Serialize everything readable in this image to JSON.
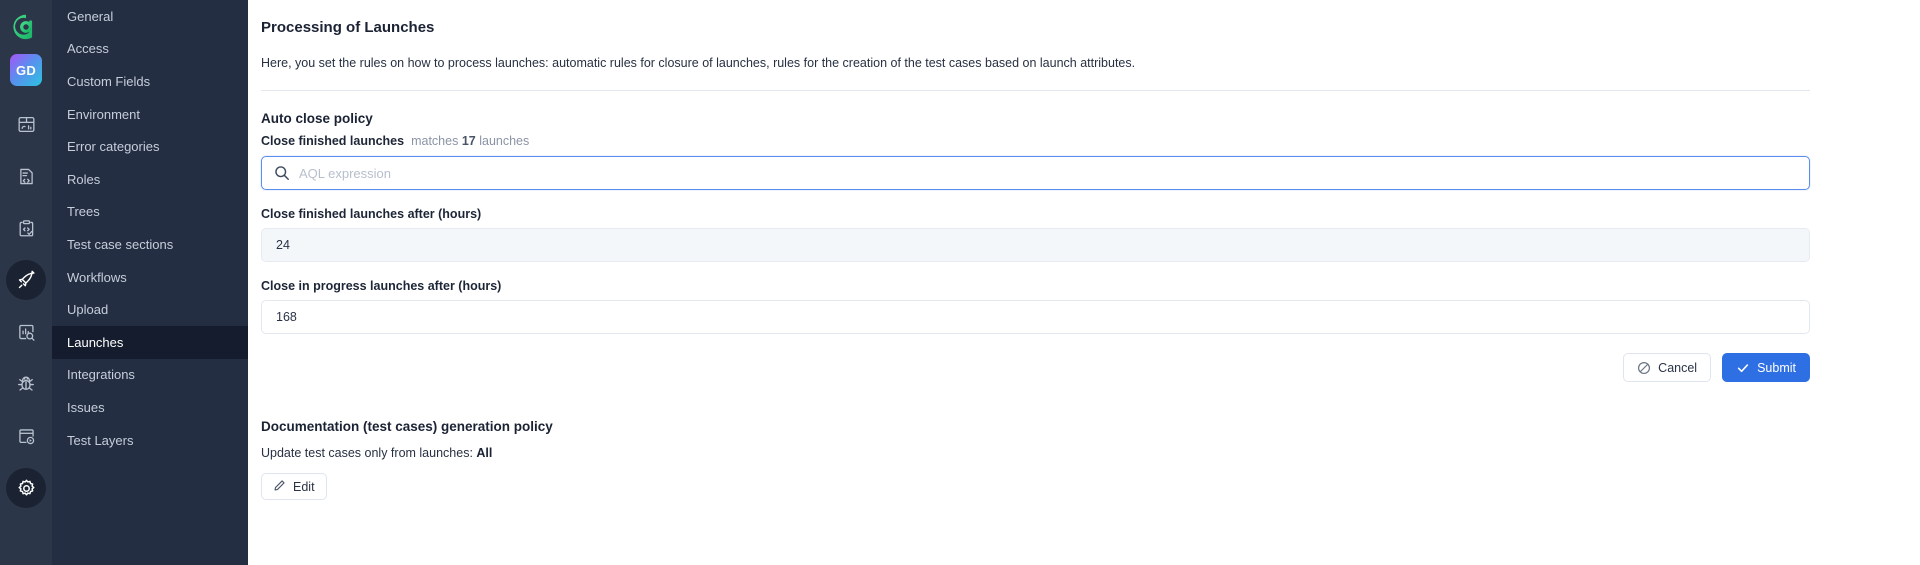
{
  "rail": {
    "avatar_initials": "GD",
    "items": [
      {
        "name": "logo-icon",
        "label": "Allure logo"
      },
      {
        "name": "avatar",
        "label": "GD"
      },
      {
        "name": "dashboards-icon",
        "label": "Dashboards"
      },
      {
        "name": "test-cases-code-icon",
        "label": "Test cases"
      },
      {
        "name": "clipboard-code-icon",
        "label": "Test plans"
      },
      {
        "name": "launches-rocket-icon",
        "label": "Launches"
      },
      {
        "name": "analytics-search-icon",
        "label": "Analytics"
      },
      {
        "name": "defects-bug-icon",
        "label": "Defects"
      },
      {
        "name": "jobs-run-icon",
        "label": "Jobs"
      },
      {
        "name": "settings-gear-icon",
        "label": "Settings"
      }
    ]
  },
  "sidebar": {
    "items": [
      {
        "label": "General",
        "active": false
      },
      {
        "label": "Access",
        "active": false
      },
      {
        "label": "Custom Fields",
        "active": false
      },
      {
        "label": "Environment",
        "active": false
      },
      {
        "label": "Error categories",
        "active": false
      },
      {
        "label": "Roles",
        "active": false
      },
      {
        "label": "Trees",
        "active": false
      },
      {
        "label": "Test case sections",
        "active": false
      },
      {
        "label": "Workflows",
        "active": false
      },
      {
        "label": "Upload",
        "active": false
      },
      {
        "label": "Launches",
        "active": true
      },
      {
        "label": "Integrations",
        "active": false
      },
      {
        "label": "Issues",
        "active": false
      },
      {
        "label": "Test Layers",
        "active": false
      }
    ]
  },
  "main": {
    "page_title": "Processing of Launches",
    "page_description": "Here, you set the rules on how to process launches: automatic rules for closure of launches, rules for the creation of the test cases based on launch attributes.",
    "auto_close": {
      "section_title": "Auto close policy",
      "field_label": "Close finished launches",
      "match_hint_prefix": "matches",
      "match_count": "17",
      "match_hint_suffix": "launches",
      "search_placeholder": "AQL expression",
      "search_value": "",
      "finished_label": "Close finished launches after (hours)",
      "finished_value": "24",
      "in_progress_label": "Close in progress launches after (hours)",
      "in_progress_value": "168",
      "cancel_label": "Cancel",
      "submit_label": "Submit"
    },
    "documentation": {
      "section_title": "Documentation (test cases) generation policy",
      "line_prefix": "Update test cases only from launches:",
      "line_value": "All",
      "edit_label": "Edit"
    }
  },
  "colors": {
    "rail_bg": "#2b3648",
    "nav_bg": "#232e42",
    "nav_active_bg": "#141c2d",
    "accent_blue": "#2f6fe4",
    "focus_blue": "#5b8def",
    "brand_green": "#2ec46a"
  }
}
